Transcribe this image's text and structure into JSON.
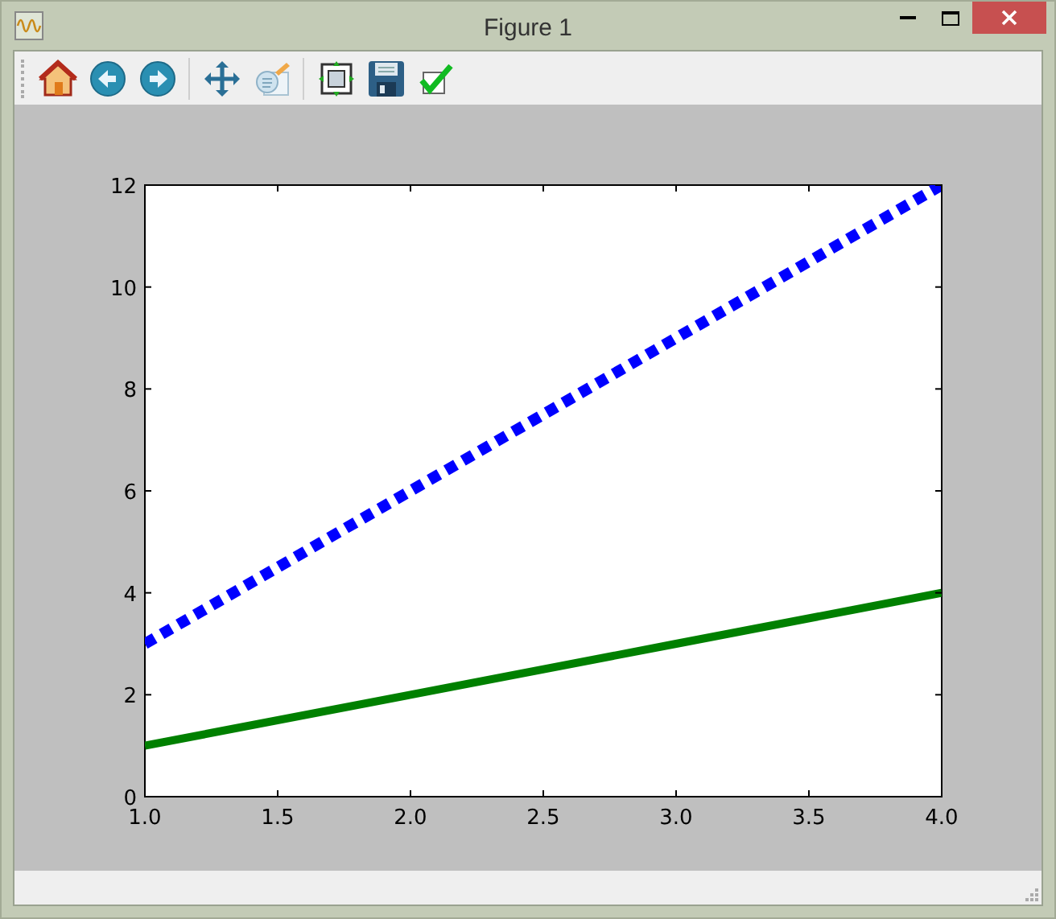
{
  "window": {
    "title": "Figure 1"
  },
  "toolbar": [
    {
      "kind": "home"
    },
    {
      "kind": "back"
    },
    {
      "kind": "forward"
    },
    {
      "kind": "separator"
    },
    {
      "kind": "pan"
    },
    {
      "kind": "zoom"
    },
    {
      "kind": "separator"
    },
    {
      "kind": "subplots"
    },
    {
      "kind": "save"
    },
    {
      "kind": "edit"
    }
  ],
  "figure": {
    "chart_data": {
      "type": "line",
      "x": [
        1,
        2,
        3,
        4
      ],
      "series": [
        {
          "color": "#0000ff",
          "line_style": "dashed",
          "values": [
            3,
            6,
            9,
            12
          ]
        },
        {
          "color": "#008000",
          "line_style": "solid",
          "values": [
            1,
            2,
            3,
            4
          ]
        }
      ],
      "xlim": [
        1,
        4
      ],
      "ylim": [
        0,
        12
      ],
      "xticks": [
        {
          "value": 1,
          "label": "1.0"
        },
        {
          "value": 1.5,
          "label": "1.5"
        },
        {
          "value": 2,
          "label": "2.0"
        },
        {
          "value": 2.5,
          "label": "2.5"
        },
        {
          "value": 3,
          "label": "3.0"
        },
        {
          "value": 3.5,
          "label": "3.5"
        },
        {
          "value": 4,
          "label": "4.0"
        }
      ],
      "yticks": [
        0,
        2,
        4,
        6,
        8,
        10,
        12
      ]
    }
  }
}
